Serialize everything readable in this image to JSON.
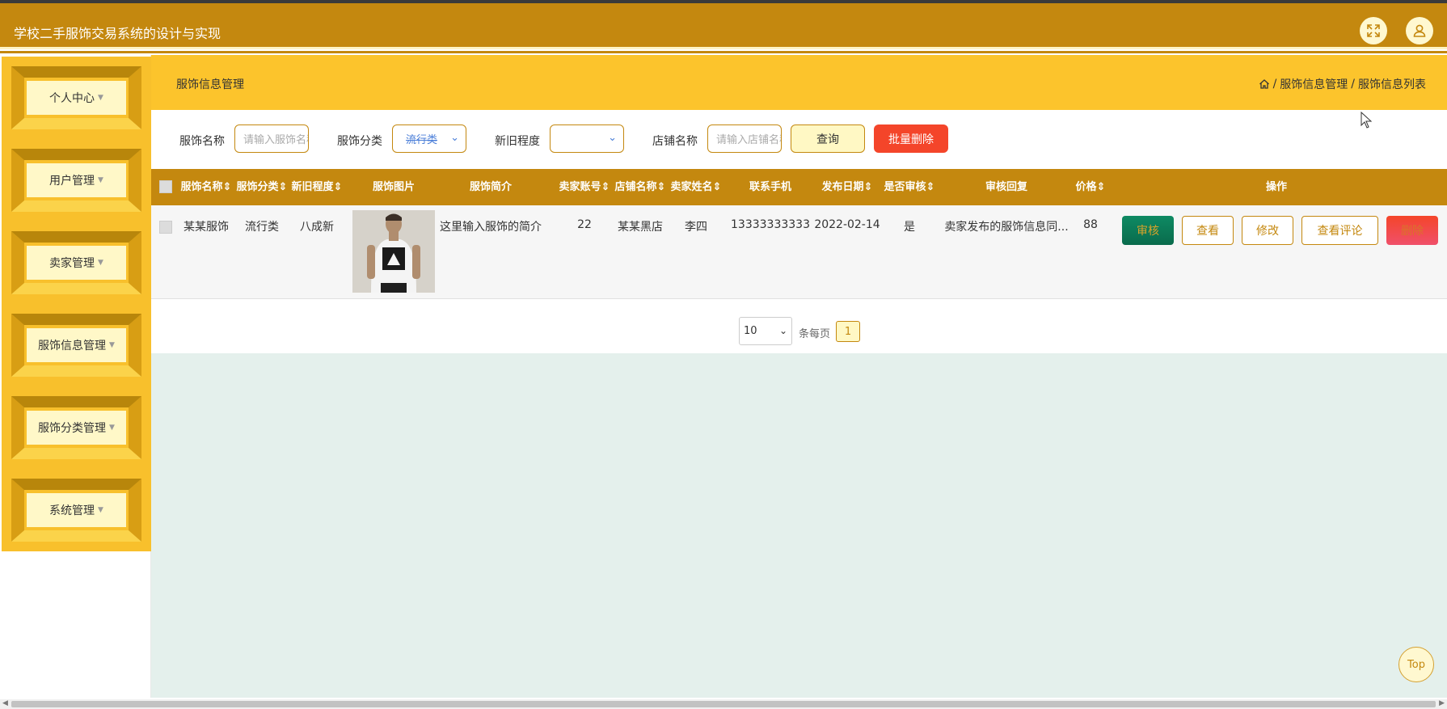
{
  "app": {
    "title": "学校二手服饰交易系统的设计与实现"
  },
  "header": {
    "fullscreen_icon": "expand-icon",
    "user_icon": "user-icon"
  },
  "sidebar": {
    "items": [
      {
        "label": "个人中心"
      },
      {
        "label": "用户管理"
      },
      {
        "label": "卖家管理"
      },
      {
        "label": "服饰信息管理"
      },
      {
        "label": "服饰分类管理"
      },
      {
        "label": "系统管理"
      }
    ]
  },
  "page": {
    "title": "服饰信息管理",
    "breadcrumb": [
      "服饰信息管理",
      "服饰信息列表"
    ],
    "sep": "/"
  },
  "search": {
    "name_label": "服饰名称",
    "name_placeholder": "请输入服饰名称",
    "category_label": "服饰分类",
    "category_value": "流行类",
    "condition_label": "新旧程度",
    "condition_value": "",
    "shop_label": "店铺名称",
    "shop_placeholder": "请输入店铺名称",
    "query_button": "查询",
    "batch_delete_button": "批量删除"
  },
  "table": {
    "headers": [
      "服饰名称",
      "服饰分类",
      "新旧程度",
      "服饰图片",
      "服饰简介",
      "卖家账号",
      "店铺名称",
      "卖家姓名",
      "联系手机",
      "发布日期",
      "是否审核",
      "审核回复",
      "价格",
      "操作"
    ],
    "rows": [
      {
        "name": "某某服饰",
        "category": "流行类",
        "condition": "八成新",
        "intro": "这里输入服饰的简介",
        "seller_account": "22",
        "shop": "某某黑店",
        "seller_name": "李四",
        "phone": "13333333333",
        "date": "2022-02-14",
        "audited": "是",
        "reply": "卖家发布的服饰信息同...",
        "price": "88",
        "actions": {
          "review": "审核",
          "view": "查看",
          "edit": "修改",
          "comments": "查看评论",
          "delete": "删除"
        }
      }
    ]
  },
  "pagination": {
    "page_size": "10",
    "per_page_label": "条每页",
    "current_page": "1"
  },
  "back_to_top": "Top",
  "colors": {
    "primary": "#c4880f",
    "bar": "#fcc42c",
    "accent_bg": "#fff8c4",
    "danger": "#f4452a",
    "review_green": "#0e7a5a",
    "content_bg": "#e4f0ec"
  }
}
